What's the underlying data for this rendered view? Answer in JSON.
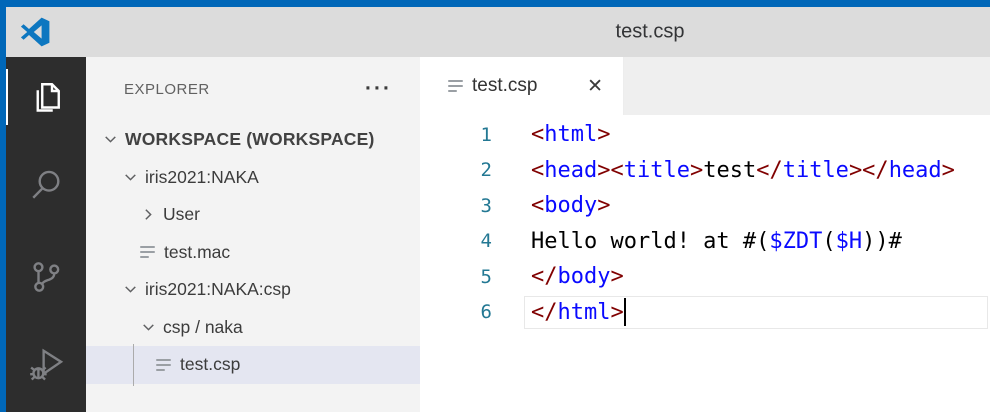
{
  "window": {
    "title": "test.csp"
  },
  "colors": {
    "accent": "#0067b8",
    "titlebar_bg": "#dcdcdc",
    "activitybar_bg": "#2d2d2d",
    "sidebar_bg": "#f3f3f3",
    "selected_bg": "#e4e6f1",
    "tabbar_bg": "#efefef",
    "editor_bg": "#ffffff",
    "punct": "#800000",
    "tag": "#0a0aff",
    "variable": "#0a0aff",
    "line_number": "#237893"
  },
  "activity_bar": {
    "items": [
      {
        "name": "explorer",
        "icon": "files-icon",
        "active": true
      },
      {
        "name": "search",
        "icon": "search-icon",
        "active": false
      },
      {
        "name": "source-control",
        "icon": "source-control-icon",
        "active": false
      },
      {
        "name": "run-debug",
        "icon": "debug-icon",
        "active": false
      }
    ]
  },
  "sidebar": {
    "title": "EXPLORER",
    "actions": "···",
    "tree": [
      {
        "label": "WORKSPACE (WORKSPACE)",
        "level": 1,
        "chevron": "down",
        "bold": true,
        "selected": false
      },
      {
        "label": "iris2021:NAKA",
        "level": 2,
        "chevron": "down",
        "bold": false,
        "selected": false
      },
      {
        "label": "User",
        "level": 3,
        "chevron": "right",
        "bold": false,
        "selected": false
      },
      {
        "label": "test.mac",
        "level": 3,
        "icon": "file",
        "bold": false,
        "selected": false
      },
      {
        "label": "iris2021:NAKA:csp",
        "level": 2,
        "chevron": "down",
        "bold": false,
        "selected": false
      },
      {
        "label": "csp / naka",
        "level": 3,
        "chevron": "down",
        "bold": false,
        "selected": false
      },
      {
        "label": "test.csp",
        "level": 4,
        "icon": "file",
        "bold": false,
        "selected": true
      }
    ]
  },
  "editor": {
    "tab": {
      "label": "test.csp",
      "icon": "file-icon",
      "close": "✕"
    },
    "lines": [
      {
        "n": "1",
        "tokens": [
          [
            "p",
            "<"
          ],
          [
            "t",
            "html"
          ],
          [
            "p",
            ">"
          ]
        ],
        "cursor": false,
        "current": false
      },
      {
        "n": "2",
        "tokens": [
          [
            "p",
            "<"
          ],
          [
            "t",
            "head"
          ],
          [
            "p",
            "><"
          ],
          [
            "t",
            "title"
          ],
          [
            "p",
            ">"
          ],
          [
            "x",
            "test"
          ],
          [
            "p",
            "</"
          ],
          [
            "t",
            "title"
          ],
          [
            "p",
            "></"
          ],
          [
            "t",
            "head"
          ],
          [
            "p",
            ">"
          ]
        ],
        "cursor": false,
        "current": false
      },
      {
        "n": "3",
        "tokens": [
          [
            "p",
            "<"
          ],
          [
            "t",
            "body"
          ],
          [
            "p",
            ">"
          ]
        ],
        "cursor": false,
        "current": false
      },
      {
        "n": "4",
        "tokens": [
          [
            "x",
            "Hello world! at #("
          ],
          [
            "v",
            "$ZDT"
          ],
          [
            "x",
            "("
          ],
          [
            "v",
            "$H"
          ],
          [
            "x",
            "))#"
          ]
        ],
        "cursor": false,
        "current": false
      },
      {
        "n": "5",
        "tokens": [
          [
            "p",
            "</"
          ],
          [
            "t",
            "body"
          ],
          [
            "p",
            ">"
          ]
        ],
        "cursor": false,
        "current": false
      },
      {
        "n": "6",
        "tokens": [
          [
            "p",
            "</"
          ],
          [
            "t",
            "html"
          ],
          [
            "p",
            ">"
          ]
        ],
        "cursor": true,
        "current": true
      }
    ]
  }
}
